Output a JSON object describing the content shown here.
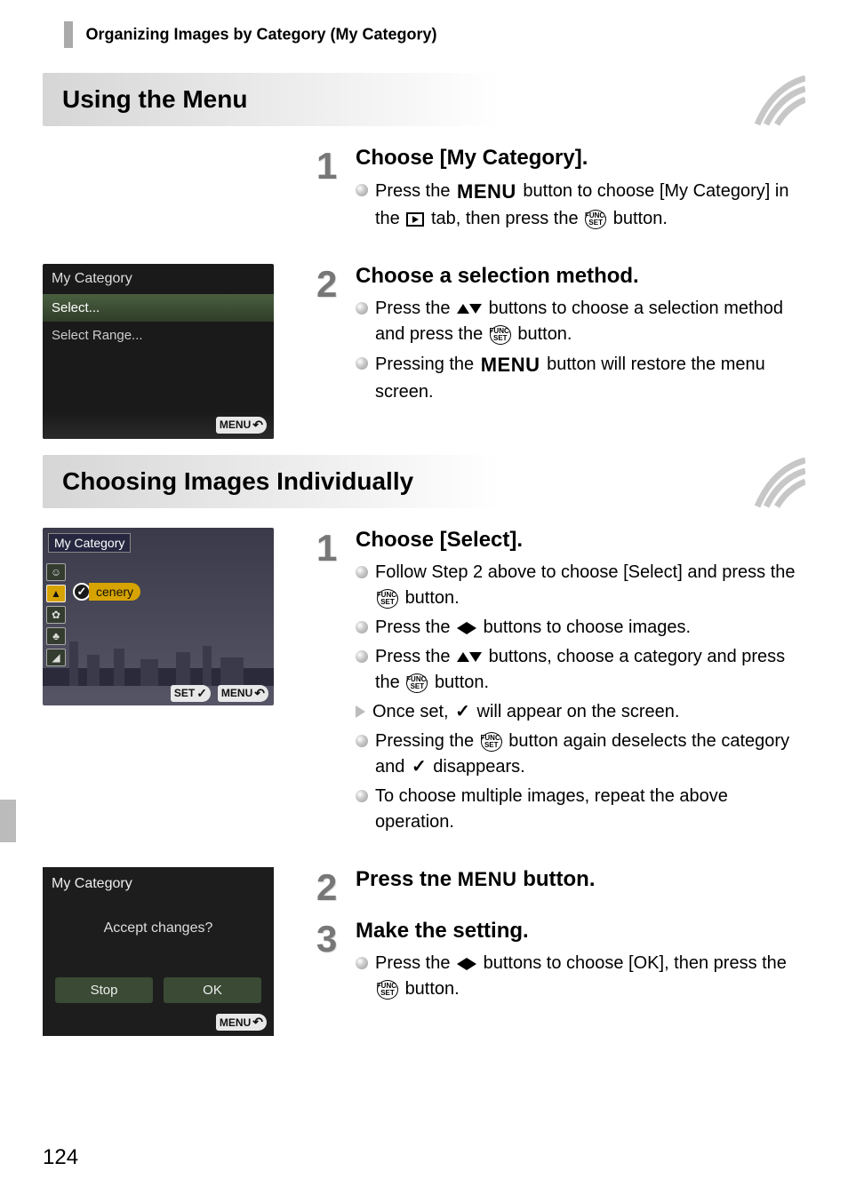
{
  "header": {
    "title": "Organizing Images by Category (My Category)"
  },
  "section1": {
    "heading": "Using the Menu",
    "lcd": {
      "title": "My Category",
      "options": [
        "Select...",
        "Select Range..."
      ],
      "menu_chip": "MENU"
    },
    "step1": {
      "num": "1",
      "title": "Choose [My Category].",
      "b1a": "Press the",
      "b1_menu": "MENU",
      "b1b": "button to choose [My Category] in the",
      "b1c": "tab, then press the",
      "b1d": "button."
    },
    "step2": {
      "num": "2",
      "title": "Choose a selection method.",
      "b1a": "Press the",
      "b1b": "buttons to choose a selection method and press the",
      "b1c": "button.",
      "b2a": "Pressing the",
      "b2_menu": "MENU",
      "b2b": "button will restore the menu screen."
    }
  },
  "section2": {
    "heading": "Choosing Images Individually",
    "lcd_photo": {
      "top": "My Category",
      "tag": "cenery",
      "set_chip": "SET",
      "menu_chip": "MENU"
    },
    "lcd_confirm": {
      "title": "My Category",
      "msg": "Accept changes?",
      "btn_stop": "Stop",
      "btn_ok": "OK",
      "menu_chip": "MENU"
    },
    "step1": {
      "num": "1",
      "title": "Choose [Select].",
      "b1a": "Follow Step 2 above to choose [Select] and press the",
      "b1b": "button.",
      "b2a": "Press the",
      "b2b": "buttons to choose images.",
      "b3a": "Press the",
      "b3b": "buttons, choose a category and press the",
      "b3c": "button.",
      "b4a": "Once set,",
      "b4b": "will appear on the screen.",
      "b5a": "Pressing the",
      "b5b": "button again deselects the category and",
      "b5c": "disappears.",
      "b6": "To choose multiple images, repeat the above operation."
    },
    "step2": {
      "num": "2",
      "title_a": "Press tne",
      "title_menu": "MENU",
      "title_b": "button."
    },
    "step3": {
      "num": "3",
      "title": "Make the setting.",
      "b1a": "Press the",
      "b1b": "buttons to choose [OK], then press the",
      "b1c": "button."
    }
  },
  "page_number": "124",
  "icons": {
    "func_top": "FUNC.",
    "func_bot": "SET"
  }
}
